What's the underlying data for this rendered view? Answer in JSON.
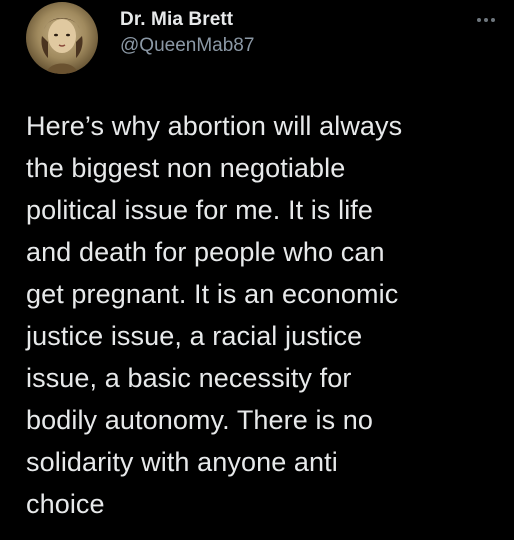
{
  "author": {
    "display_name": "Dr. Mia Brett",
    "handle": "@QueenMab87",
    "avatar_icon": "profile-portrait"
  },
  "menu": {
    "more_icon": "more-horizontal-icon"
  },
  "tweet": {
    "text": "Here’s why abortion will always\nthe biggest non negotiable\npolitical issue for me. It is life\nand death for people who can\nget pregnant. It is an economic\njustice issue, a racial justice\nissue, a basic necessity for\nbodily autonomy. There is no\nsolidarity with anyone anti\nchoice"
  },
  "colors": {
    "background": "#000000",
    "primary_text": "#e7e9ea",
    "secondary_text": "#8b98a5"
  }
}
